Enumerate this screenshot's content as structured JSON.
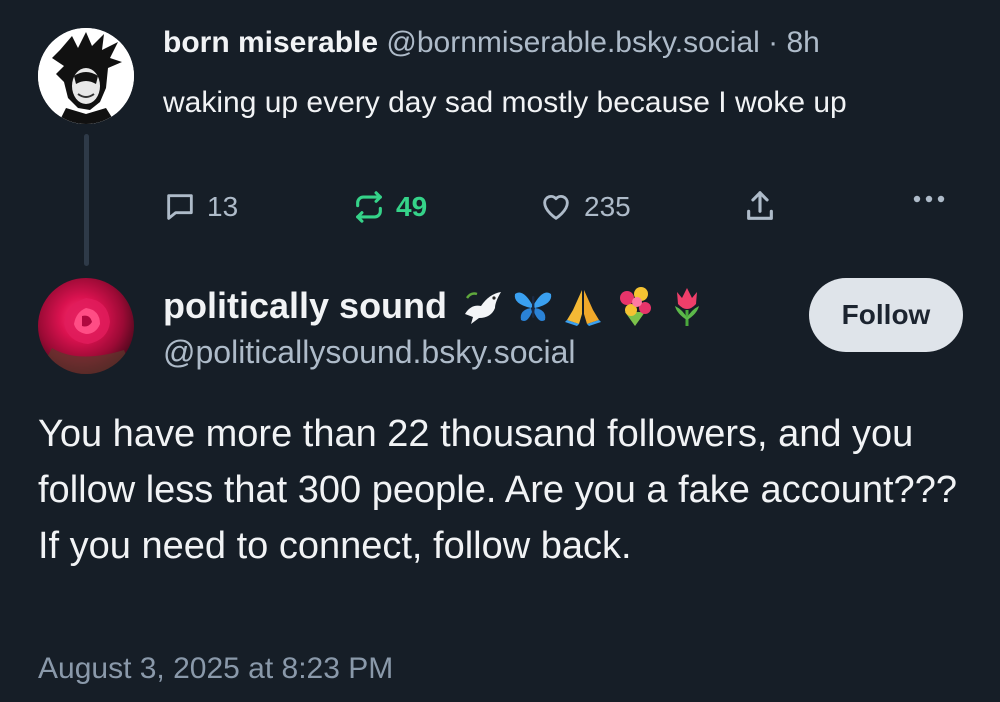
{
  "parent_post": {
    "author_name": "born miserable",
    "author_handle": "@bornmiserable.bsky.social",
    "separator": "·",
    "time": "8h",
    "text": "waking up every day sad mostly because I woke up",
    "reply_count": "13",
    "repost_count": "49",
    "like_count": "235",
    "repost_color": "#35d389"
  },
  "main_post": {
    "author_name": "politically sound",
    "author_emojis": [
      "dove-emoji",
      "butterfly-emoji",
      "folded-hands-emoji",
      "bouquet-emoji",
      "tulip-emoji"
    ],
    "author_handle": "@politicallysound.bsky.social",
    "follow_label": "Follow",
    "text": "You have more than 22 thousand followers, and you follow less that 300 people. Are you a fake account??? If you need to connect, follow back.",
    "timestamp": "August 3, 2025 at 8:23 PM"
  },
  "colors": {
    "background": "#161e27",
    "text_primary": "#f1f3f5",
    "text_secondary": "#aebbc9",
    "follow_button_bg": "#dfe4ea"
  }
}
